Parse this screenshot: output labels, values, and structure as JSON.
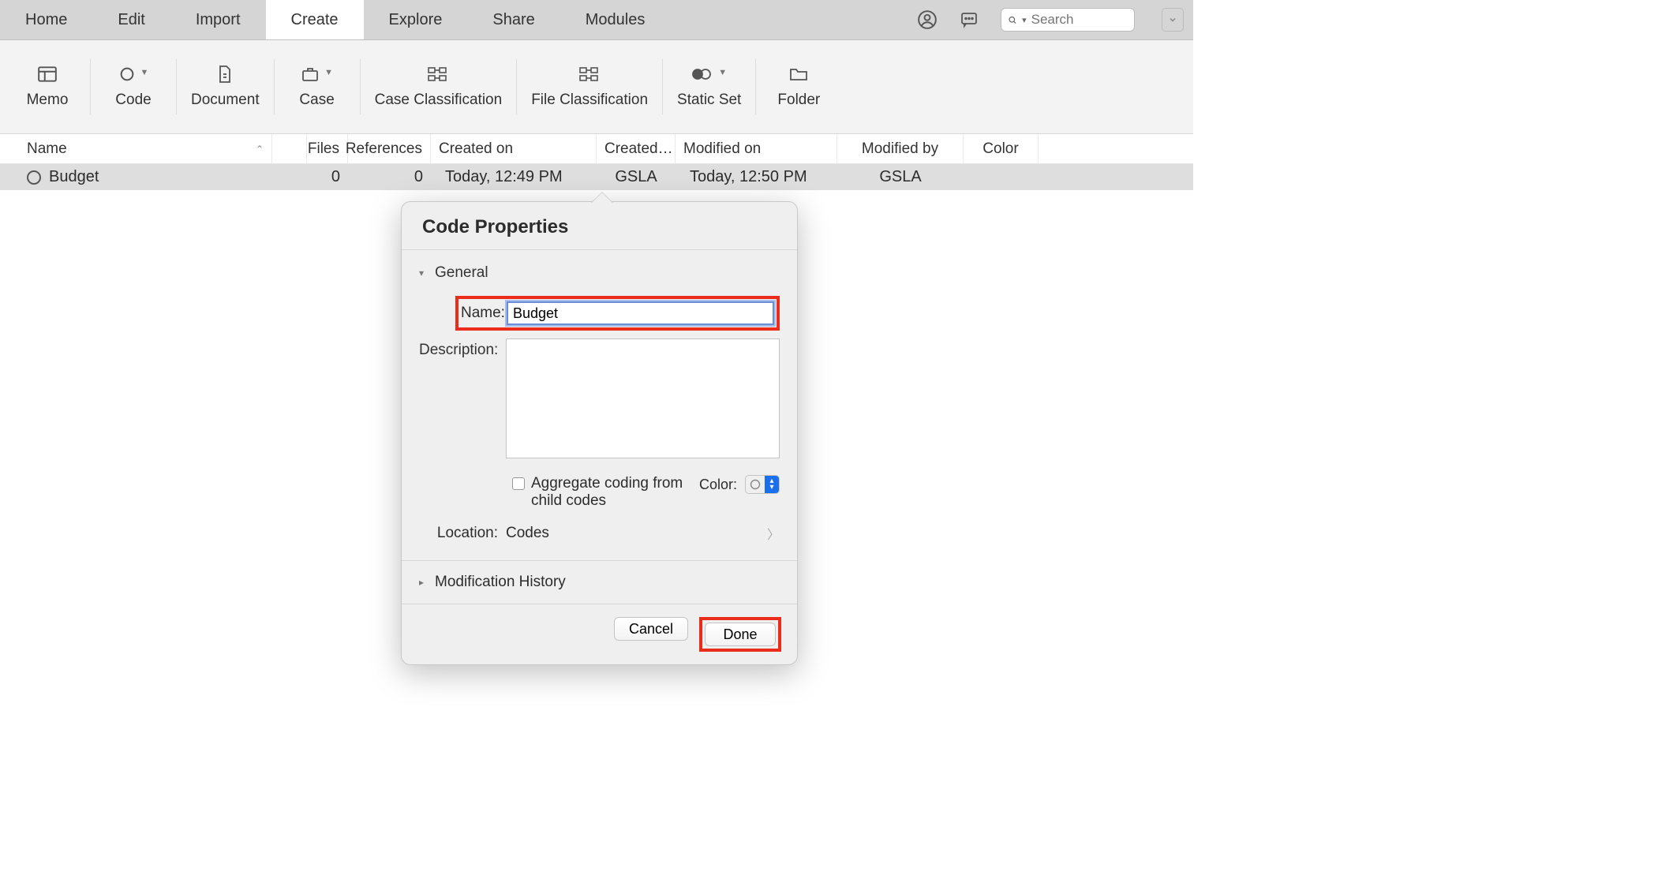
{
  "menubar": {
    "tabs": [
      "Home",
      "Edit",
      "Import",
      "Create",
      "Explore",
      "Share",
      "Modules"
    ],
    "active_index": 3,
    "search_placeholder": "Search"
  },
  "ribbon": {
    "items": [
      {
        "label": "Memo"
      },
      {
        "label": "Code",
        "dropdown": true
      },
      {
        "label": "Document"
      },
      {
        "label": "Case",
        "dropdown": true
      },
      {
        "label": "Case Classification"
      },
      {
        "label": "File Classification"
      },
      {
        "label": "Static Set",
        "dropdown": true
      },
      {
        "label": "Folder"
      }
    ]
  },
  "table": {
    "headers": {
      "name": "Name",
      "files": "Files",
      "references": "References",
      "created_on": "Created on",
      "created_by": "Created…",
      "modified_on": "Modified on",
      "modified_by": "Modified by",
      "color": "Color"
    },
    "rows": [
      {
        "name": "Budget",
        "files": "0",
        "references": "0",
        "created_on": "Today, 12:49 PM",
        "created_by": "GSLA",
        "modified_on": "Today, 12:50 PM",
        "modified_by": "GSLA",
        "color": ""
      }
    ]
  },
  "popover": {
    "title": "Code Properties",
    "general_label": "General",
    "name_label": "Name:",
    "name_value": "Budget",
    "description_label": "Description:",
    "description_value": "",
    "aggregate_label": "Aggregate coding from child codes",
    "color_label": "Color:",
    "location_label": "Location:",
    "location_value": "Codes",
    "mod_history_label": "Modification History",
    "cancel_label": "Cancel",
    "done_label": "Done"
  }
}
